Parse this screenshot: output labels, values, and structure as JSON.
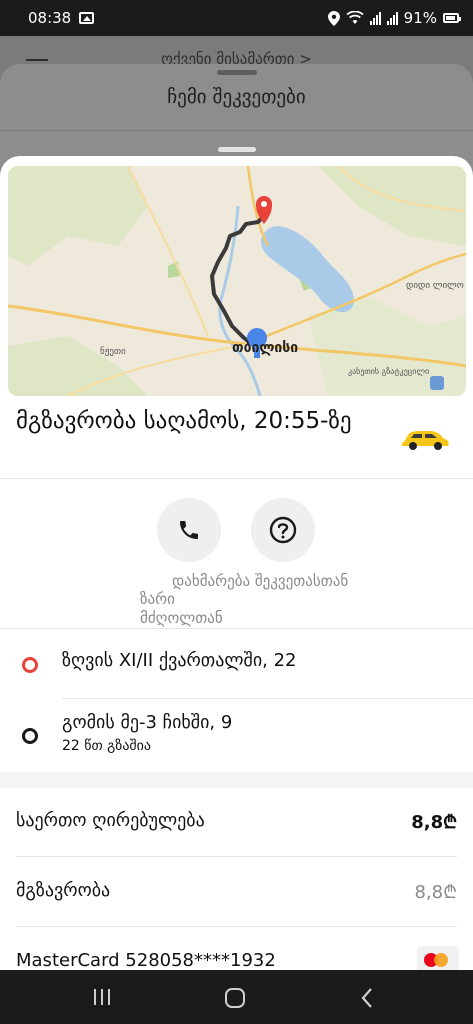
{
  "status_bar": {
    "time": "08:38",
    "battery": "91%"
  },
  "background": {
    "peek_text": "ოქვენი მისამართი >",
    "sheet_title": "ჩემი შეკვეთები"
  },
  "map": {
    "labels": {
      "city": "თბილისი",
      "left_town": "ნჟეთი",
      "right_top": "დიდი ლილო",
      "right_mid": "კახეთის გზატკეცილი"
    }
  },
  "trip": {
    "title": "მგზავრობა საღამოს, 20:55-ზე",
    "car_icon": "taxi-car-icon"
  },
  "actions": {
    "call_label": "ზარი მძღოლთან",
    "help_label": "დახმარება შეკვეთასთან"
  },
  "route": {
    "from": "ზღვის XI/II ქვართალში, 22",
    "to": "გომის მე-3 ჩიხში, 9",
    "to_note": "22 წთ გზაშია"
  },
  "pricing": {
    "total_label": "საერთო ღირებულება",
    "total_value": "8,8₾",
    "ride_label": "მგზავრობა",
    "ride_value": "8,8₾",
    "card_label": "MasterCard 528058****1932"
  },
  "colors": {
    "start_point": "#e8433a",
    "route_line": "#3a3a3a",
    "taxi_yellow": "#f5c518",
    "water": "#a9cbe8"
  }
}
